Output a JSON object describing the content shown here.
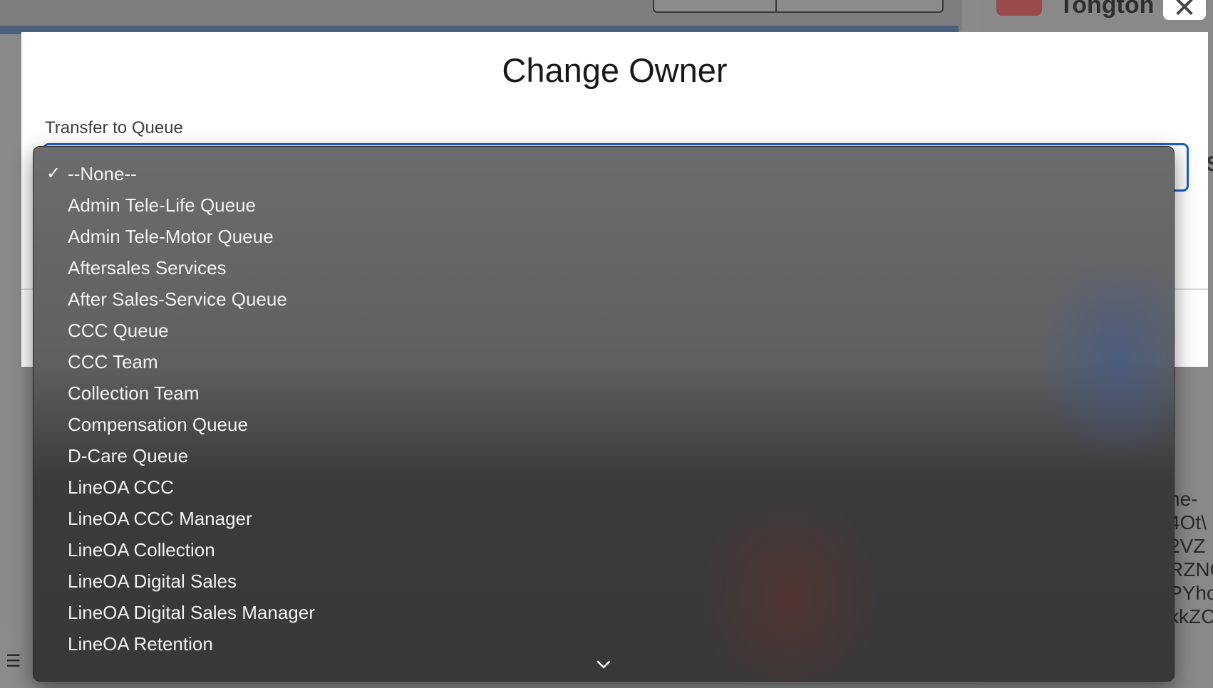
{
  "modal": {
    "title": "Change Owner",
    "field_label": "Transfer to Queue",
    "selected_value": "--None--"
  },
  "dropdown": {
    "options": [
      {
        "label": "--None--",
        "selected": true
      },
      {
        "label": "Admin Tele-Life Queue",
        "selected": false
      },
      {
        "label": "Admin Tele-Motor Queue",
        "selected": false
      },
      {
        "label": "Aftersales Services",
        "selected": false
      },
      {
        "label": "After Sales-Service Queue",
        "selected": false
      },
      {
        "label": "CCC Queue",
        "selected": false
      },
      {
        "label": "CCC Team",
        "selected": false
      },
      {
        "label": "Collection Team",
        "selected": false
      },
      {
        "label": "Compensation Queue",
        "selected": false
      },
      {
        "label": "D-Care Queue",
        "selected": false
      },
      {
        "label": "LineOA CCC",
        "selected": false
      },
      {
        "label": "LineOA CCC Manager",
        "selected": false
      },
      {
        "label": "LineOA Collection",
        "selected": false
      },
      {
        "label": "LineOA Digital Sales",
        "selected": false
      },
      {
        "label": "LineOA Digital Sales Manager",
        "selected": false
      },
      {
        "label": "LineOA Retention",
        "selected": false
      }
    ],
    "check_glyph": "✓",
    "scroll_icon": "chevron-down-icon"
  },
  "background": {
    "user_name": "Tongton",
    "close_glyph": "✕",
    "side_text": "ne-\n4Ot\\\n2VZ\nRZNC\nPYhc\nkkZC",
    "right_letter": "S",
    "list_icon": "list-icon"
  },
  "colors": {
    "select_border": "#1b5fc4",
    "primary_button": "#2d6fc7"
  }
}
